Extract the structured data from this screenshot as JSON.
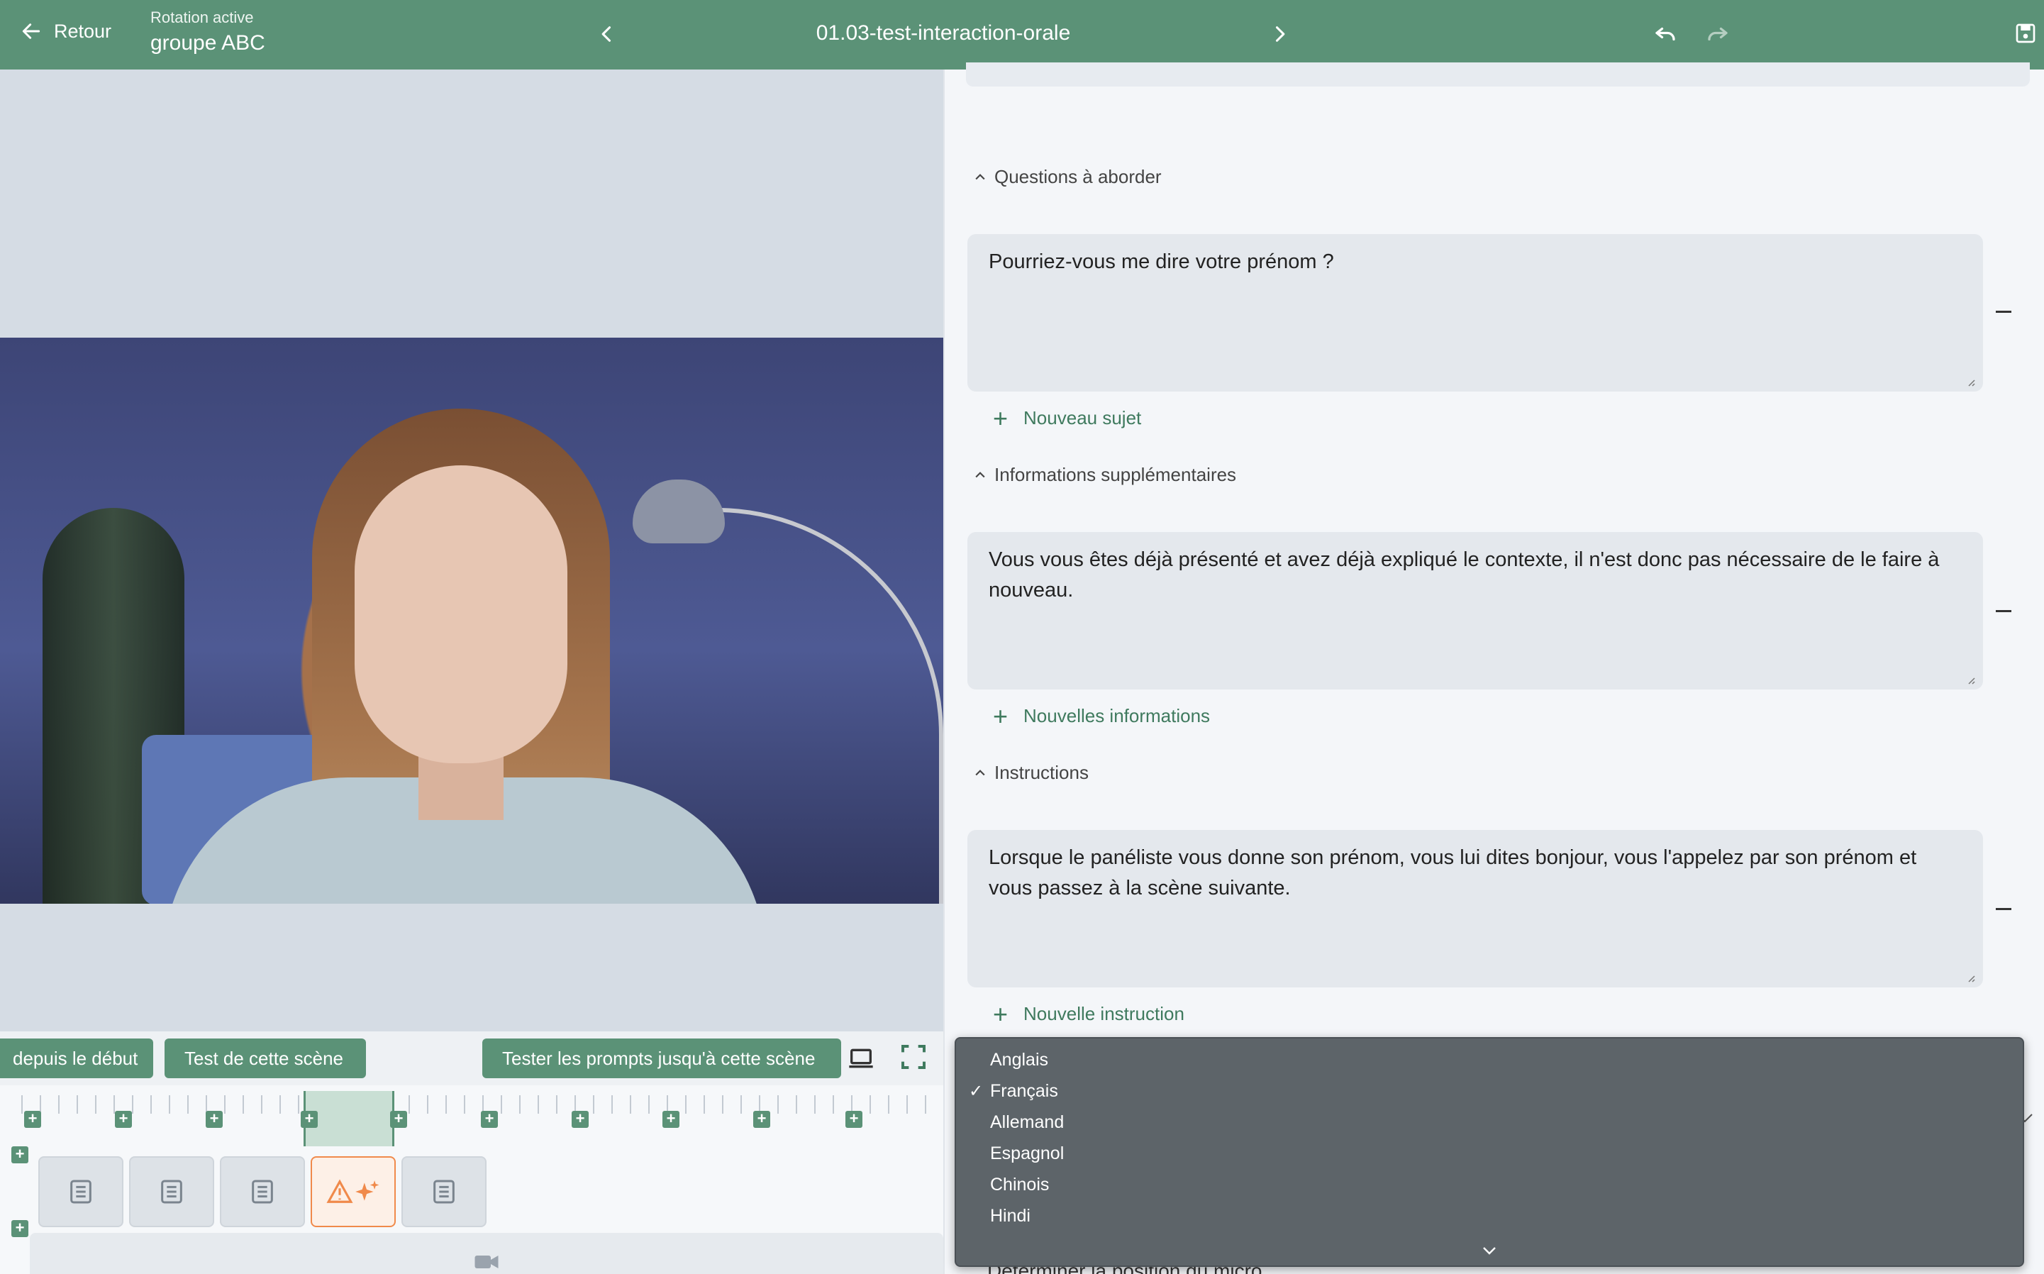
{
  "topbar": {
    "back_label": "Retour",
    "rotation_label": "Rotation active",
    "rotation_value": "groupe ABC",
    "title": "01.03-test-interaction-orale"
  },
  "toolbar": {
    "from_start": "depuis le début",
    "test_scene": "Test de cette scène",
    "test_prompts": "Tester les prompts jusqu'à cette scène"
  },
  "sections": {
    "questions": {
      "heading": "Questions à aborder",
      "text": "Pourriez-vous me dire votre prénom ?",
      "add_label": "Nouveau sujet"
    },
    "info": {
      "heading": "Informations supplémentaires",
      "text": "Vous vous êtes déjà présenté et avez déjà expliqué le contexte, il n'est donc pas nécessaire de le faire à nouveau.",
      "add_label": "Nouvelles informations"
    },
    "instructions": {
      "heading": "Instructions",
      "text": "Lorsque le panéliste vous donne son prénom, vous lui dites bonjour, vous l'appelez par son prénom et vous passez à la scène suivante.",
      "add_label": "Nouvelle instruction"
    }
  },
  "language_dropdown": {
    "options": [
      "Anglais",
      "Français",
      "Allemand",
      "Espagnol",
      "Chinois",
      "Hindi"
    ],
    "selected": "Français",
    "check_mark": "✓"
  },
  "partial_text": "Déterminer la position du micro",
  "colors": {
    "accent": "#5b9277",
    "warning": "#f08a4b",
    "dropdown_bg": "#5d6469"
  }
}
